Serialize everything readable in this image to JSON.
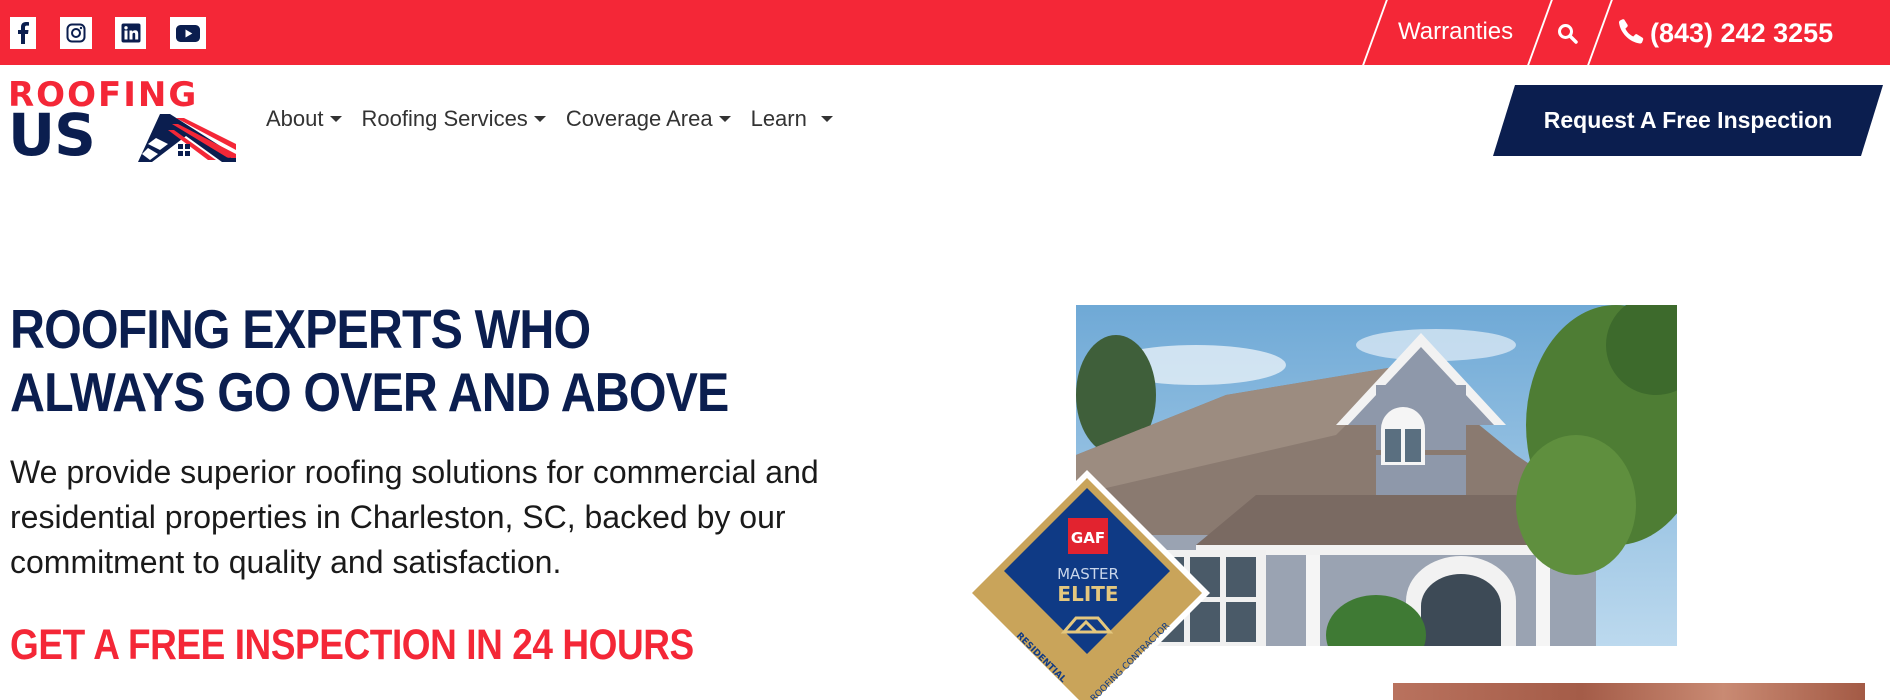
{
  "topbar": {
    "social": [
      {
        "icon": "facebook-icon",
        "label": "Facebook"
      },
      {
        "icon": "instagram-icon",
        "label": "Instagram"
      },
      {
        "icon": "linkedin-icon",
        "label": "LinkedIn"
      },
      {
        "icon": "youtube-icon",
        "label": "YouTube"
      }
    ],
    "warranties": "Warranties",
    "search_icon": "search-icon",
    "phone": "(843) 242 3255",
    "phone_icon": "phone-icon"
  },
  "logo": {
    "top_word": "ROOFING",
    "bottom_word": "US"
  },
  "nav": {
    "items": [
      "About",
      "Roofing Services",
      "Coverage Area",
      "Learn"
    ]
  },
  "cta": {
    "label": "Request A Free Inspection"
  },
  "hero": {
    "title_lines": [
      "ROOFING EXPERTS WHO",
      "ALWAYS GO OVER AND ABOVE"
    ],
    "description_lines": [
      "We provide superior roofing solutions for commercial and",
      "residential properties in Charleston, SC, backed by our",
      "commitment to quality and satisfaction."
    ],
    "sub_cta": "GET A FREE INSPECTION IN 24 HOURS"
  },
  "badge": {
    "brand": "GAF",
    "line1": "MASTER",
    "line2": "ELITE",
    "ribbon_left": "RESIDENTIAL",
    "ribbon_right": "ROOFING CONTRACTOR"
  },
  "colors": {
    "brand_red": "#f42737",
    "brand_navy": "#0b1e4f",
    "badge_gold": "#c9a45a",
    "badge_blue": "#0f3a85"
  }
}
